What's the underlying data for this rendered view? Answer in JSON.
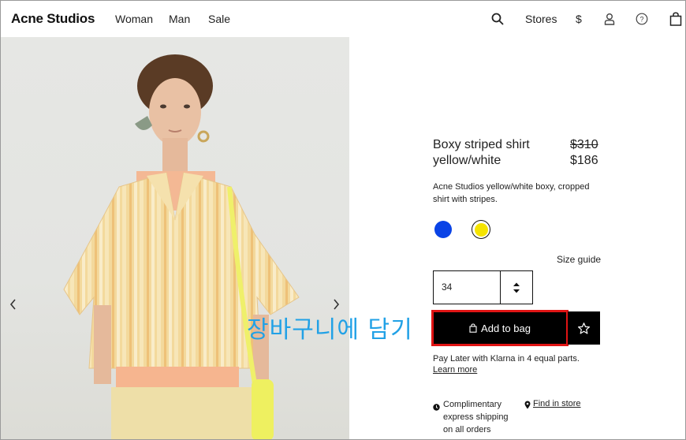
{
  "header": {
    "logo": "Acne Studios",
    "nav": [
      "Woman",
      "Man",
      "Sale"
    ],
    "stores_label": "Stores",
    "currency_label": "$",
    "icons": [
      "search-icon",
      "account-icon",
      "help-icon",
      "bag-icon"
    ]
  },
  "gallery": {
    "prev_icon": "chevron-left-icon",
    "next_icon": "chevron-right-icon"
  },
  "product": {
    "name": "Boxy striped shirt",
    "color": "yellow/white",
    "price_original": "$310",
    "price_sale": "$186",
    "description": "Acne Studios yellow/white boxy, cropped shirt with stripes.",
    "swatches": [
      {
        "name": "blue",
        "hex": "#0a43e6",
        "selected": false
      },
      {
        "name": "yellow",
        "hex": "#f5e400",
        "selected": true
      }
    ],
    "size_guide_label": "Size guide",
    "size_value": "34",
    "add_to_bag_label": "Add to bag",
    "klarna_text": "Pay Later with Klarna in 4 equal parts.",
    "learn_more_label": "Learn more",
    "shipping_text": "Complimentary express shipping on all orders",
    "find_in_store_label": "Find in store"
  },
  "annotation": {
    "label": "장바구니에 담기",
    "highlight_color": "#e01414",
    "text_color": "#21a1e6"
  }
}
